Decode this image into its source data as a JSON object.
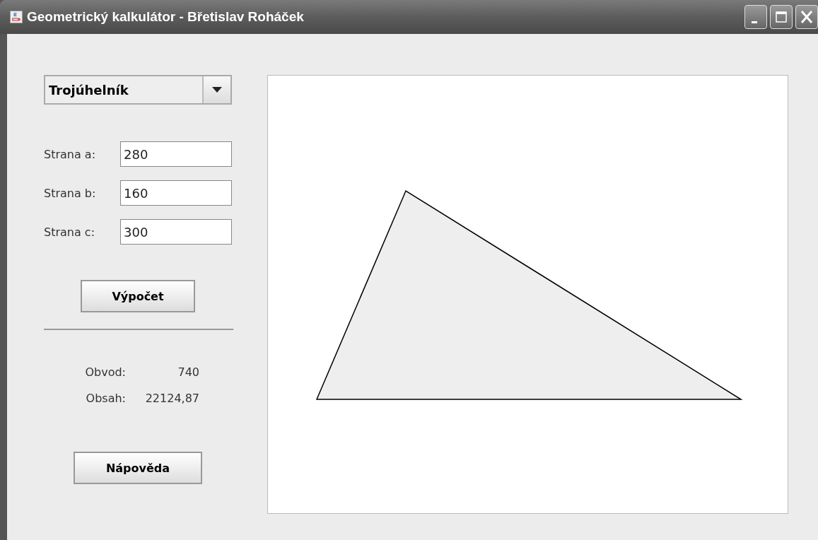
{
  "window": {
    "title": "Geometrický kalkulátor - Břetislav Roháček"
  },
  "shape_select": {
    "value": "Trojúhelník"
  },
  "fields": [
    {
      "label": "Strana a:",
      "value": "280"
    },
    {
      "label": "Strana b:",
      "value": "160"
    },
    {
      "label": "Strana c:",
      "value": "300"
    }
  ],
  "calculate_button": "Výpočet",
  "results": [
    {
      "label": "Obvod:",
      "value": "740"
    },
    {
      "label": "Obsah:",
      "value": "22124,87"
    }
  ],
  "help_button": "Nápověda"
}
